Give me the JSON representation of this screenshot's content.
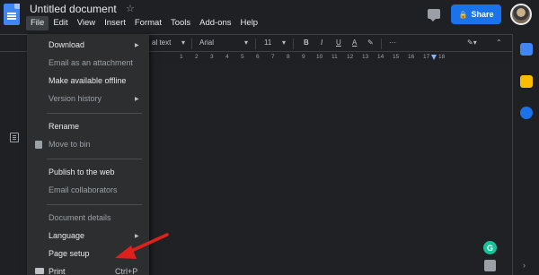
{
  "document": {
    "title": "Untitled document"
  },
  "menubar": [
    "File",
    "Edit",
    "View",
    "Insert",
    "Format",
    "Tools",
    "Add-ons",
    "Help"
  ],
  "share": {
    "label": "Share"
  },
  "toolbar": {
    "style": "al text",
    "font": "Arial",
    "size": "11",
    "bold": "B",
    "italic": "I",
    "underline": "U",
    "text_color": "A",
    "more": "···"
  },
  "ruler": [
    "1",
    "2",
    "3",
    "4",
    "5",
    "6",
    "7",
    "8",
    "9",
    "10",
    "11",
    "12",
    "13",
    "14",
    "15",
    "16",
    "17",
    "18"
  ],
  "file_menu": {
    "download": "Download",
    "email_attachment": "Email as an attachment",
    "offline": "Make available offline",
    "version_history": "Version history",
    "rename": "Rename",
    "move_to_bin": "Move to bin",
    "publish": "Publish to the web",
    "email_collaborators": "Email collaborators",
    "details": "Document details",
    "language": "Language",
    "page_setup": "Page setup",
    "print": "Print",
    "print_shortcut": "Ctrl+P"
  },
  "grammarly": {
    "label": "G"
  },
  "colors": {
    "accent": "#1a73e8",
    "menu_bg": "#2d2e30",
    "annotation_arrow": "#e0201b",
    "grammarly": "#15c39a"
  }
}
